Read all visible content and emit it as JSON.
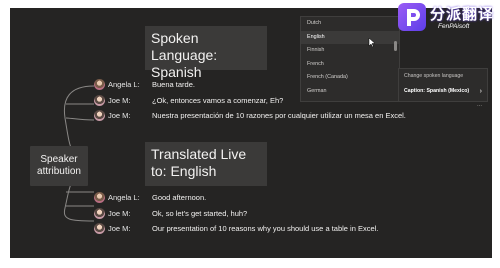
{
  "labels": {
    "speaker_attribution": "Speaker attribution",
    "spoken_heading": "Spoken Language: Spanish",
    "translated_heading": "Translated Live to: English"
  },
  "spoken_captions": [
    {
      "speaker": "Angela L:",
      "text": "Buena tarde.",
      "avatar": "angela"
    },
    {
      "speaker": "Joe M:",
      "text": "¿Ok, entonces vamos a comenzar, Eh?",
      "avatar": "joe"
    },
    {
      "speaker": "Joe M:",
      "text": "Nuestra presentación de 10 razones por cualquier utilizar un mesa en Excel.",
      "avatar": "joe"
    }
  ],
  "translated_captions": [
    {
      "speaker": "Angela L:",
      "text": "Good afternoon.",
      "avatar": "angela"
    },
    {
      "speaker": "Joe M:",
      "text": "Ok, so let's get started, huh?",
      "avatar": "joe"
    },
    {
      "speaker": "Joe M:",
      "text": "Our presentation of 10 reasons why you should use a table in Excel.",
      "avatar": "joe"
    }
  ],
  "language_menu": {
    "items": [
      "Dutch",
      "English",
      "Finnish",
      "French",
      "French (Canada)",
      "German"
    ],
    "selected": "English"
  },
  "caption_options": {
    "change_spoken_language": "Change spoken language",
    "caption_setting": "Caption: Spanish (Mexico)"
  },
  "more_label": "...",
  "watermark": {
    "cn": "分派翻译",
    "en": "FenPAisoft"
  },
  "colors": {
    "background": "#252423",
    "panel": "#3b3a39",
    "text": "#f3f2f1",
    "logo": "#7b4cf0"
  }
}
